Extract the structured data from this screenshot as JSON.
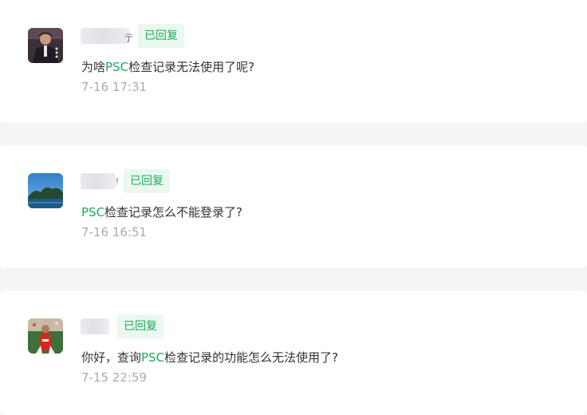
{
  "comments": [
    {
      "status": "已回复",
      "question": {
        "before": "为啥",
        "keyword": "PSC",
        "after": "检查记录无法使用了呢?"
      },
      "time": "7-16 17:31"
    },
    {
      "status": "已回复",
      "question": {
        "before": "",
        "keyword": "PSC",
        "after": "检查记录怎么不能登录了?"
      },
      "time": "7-16 16:51"
    },
    {
      "status": "已回复",
      "question": {
        "before": "你好，查询",
        "keyword": "PSC",
        "after": "检查记录的功能怎么无法使用了?"
      },
      "time": "7-15 22:59"
    }
  ],
  "colors": {
    "accent": "#1aad5a",
    "badge_bg": "#eaf8ef",
    "text": "#333333",
    "muted": "#a8abb2",
    "page_bg": "#f4f5f7"
  }
}
